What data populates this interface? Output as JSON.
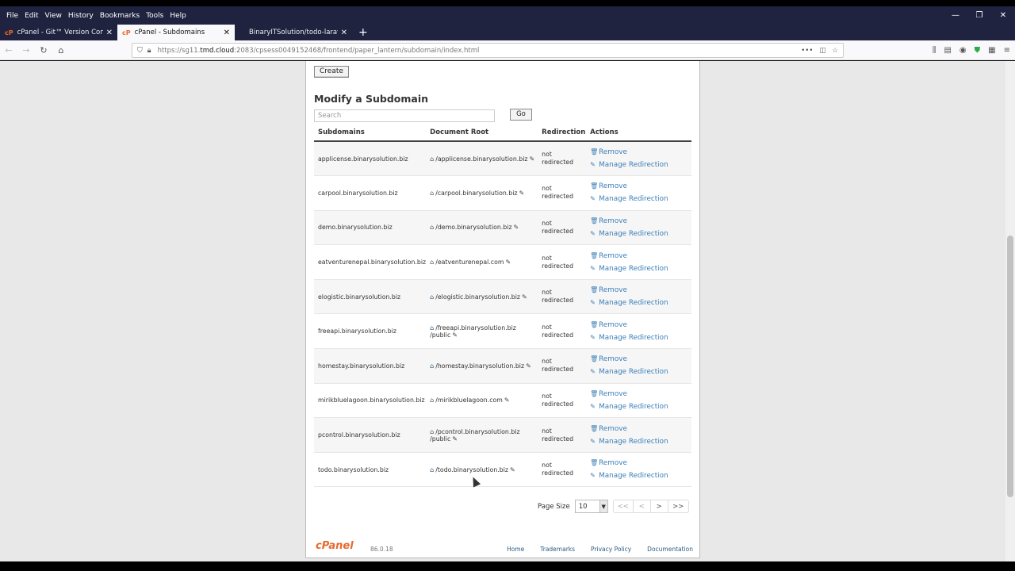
{
  "browser": {
    "menu": [
      "File",
      "Edit",
      "View",
      "History",
      "Bookmarks",
      "Tools",
      "Help"
    ],
    "window_controls": [
      "—",
      "❐",
      "✕"
    ],
    "tabs": [
      {
        "label": "cPanel - Git™ Version Control",
        "favicon": "cP",
        "active": false
      },
      {
        "label": "cPanel - Subdomains",
        "favicon": "cP",
        "active": true
      },
      {
        "label": "BinaryITSolution/todo-laravel-",
        "favicon": "",
        "active": false
      }
    ],
    "new_tab": "+",
    "url_prefix": "https://sg11.",
    "url_domain": "tmd.cloud",
    "url_rest": ":2083/cpsess0049152468/frontend/paper_lantern/subdomain/index.html"
  },
  "page": {
    "create_label": "Create",
    "section_title": "Modify a Subdomain",
    "search_placeholder": "Search",
    "go_label": "Go",
    "columns": {
      "subdomains": "Subdomains",
      "document_root": "Document Root",
      "redirection": "Redirection",
      "actions": "Actions"
    },
    "rows": [
      {
        "sub": "applicense.binarysolution.biz",
        "root": "/applicense.binarysolution.biz",
        "root2": "",
        "redir": [
          "not",
          "redirected"
        ]
      },
      {
        "sub": "carpool.binarysolution.biz",
        "root": "/carpool.binarysolution.biz",
        "root2": "",
        "redir": [
          "not",
          "redirected"
        ]
      },
      {
        "sub": "demo.binarysolution.biz",
        "root": "/demo.binarysolution.biz",
        "root2": "",
        "redir": [
          "not",
          "redirected"
        ]
      },
      {
        "sub": "eatventurenepal.binarysolution.biz",
        "root": "/eatventurenepal.com",
        "root2": "",
        "redir": [
          "not",
          "redirected"
        ]
      },
      {
        "sub": "elogistic.binarysolution.biz",
        "root": "/elogistic.binarysolution.biz",
        "root2": "",
        "redir": [
          "not",
          "redirected"
        ]
      },
      {
        "sub": "freeapi.binarysolution.biz",
        "root": "/freeapi.binarysolution.biz",
        "root2": "/public",
        "redir": [
          "not",
          "redirected"
        ]
      },
      {
        "sub": "homestay.binarysolution.biz",
        "root": "/homestay.binarysolution.biz",
        "root2": "",
        "redir": [
          "not",
          "redirected"
        ]
      },
      {
        "sub": "mirikbluelagoon.binarysolution.biz",
        "root": "/mirikbluelagoon.com",
        "root2": "",
        "redir": [
          "not",
          "redirected"
        ]
      },
      {
        "sub": "pcontrol.binarysolution.biz",
        "root": "/pcontrol.binarysolution.biz",
        "root2": "/public",
        "redir": [
          "not",
          "redirected"
        ]
      },
      {
        "sub": "todo.binarysolution.biz",
        "root": "/todo.binarysolution.biz",
        "root2": "",
        "redir": [
          "not",
          "redirected"
        ]
      }
    ],
    "action_remove": "Remove",
    "action_manage": "Manage Redirection",
    "pager": {
      "page_size_label": "Page Size",
      "page_size_value": "10",
      "first": "<<",
      "prev": "<",
      "next": ">",
      "last": ">>"
    },
    "footer": {
      "logo": "cPanel",
      "version": "86.0.18",
      "links": [
        "Home",
        "Trademarks",
        "Privacy Policy",
        "Documentation"
      ]
    }
  }
}
